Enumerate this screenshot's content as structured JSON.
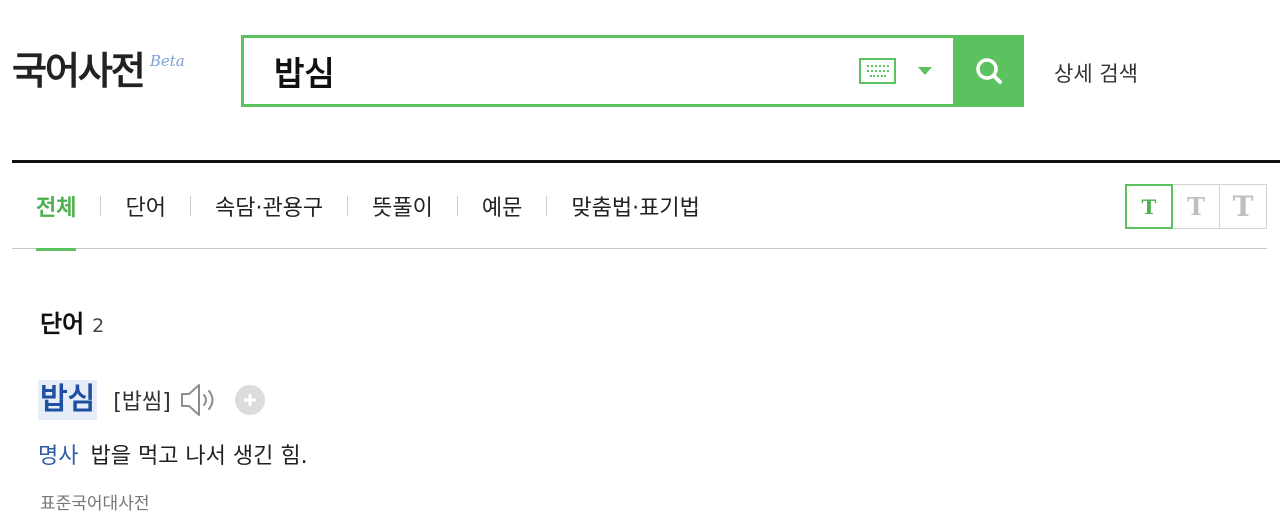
{
  "header": {
    "logo_text": "국어사전",
    "logo_badge": "Beta",
    "search_value": "밥심",
    "detail_search_label": "상세 검색",
    "accent_color": "#5cc15f"
  },
  "tabs": [
    {
      "label": "전체",
      "active": true
    },
    {
      "label": "단어",
      "active": false
    },
    {
      "label": "속담·관용구",
      "active": false
    },
    {
      "label": "뜻풀이",
      "active": false
    },
    {
      "label": "예문",
      "active": false
    },
    {
      "label": "맞춤법·표기법",
      "active": false
    }
  ],
  "font_size_buttons": [
    "T",
    "T",
    "T"
  ],
  "results": {
    "section_label": "단어",
    "section_count": "2",
    "entry": {
      "word": "밥심",
      "pronunciation": "[밥씸]",
      "part_of_speech": "명사",
      "definition": "밥을 먹고 나서 생긴 힘.",
      "source": "표준국어대사전"
    }
  }
}
